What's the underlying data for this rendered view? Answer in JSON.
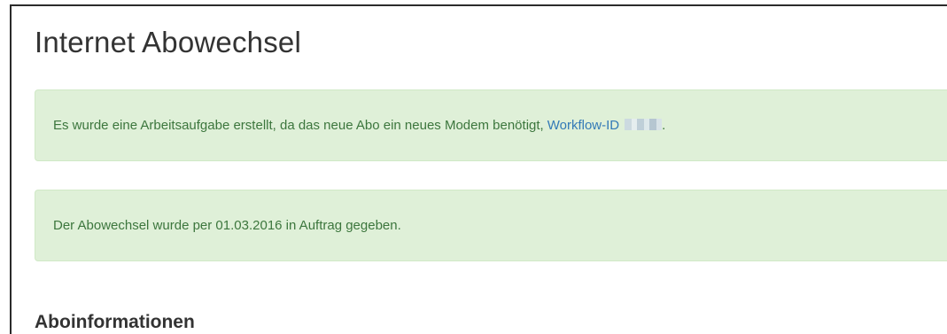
{
  "page": {
    "title": "Internet Abowechsel"
  },
  "alerts": [
    {
      "text": "Es wurde eine Arbeitsaufgabe erstellt, da das neue Abo ein neues Modem benötigt,",
      "link_label": "Workflow-ID",
      "link_suffix": "."
    },
    {
      "text": "Der Abowechsel wurde per 01.03.2016 in Auftrag gegeben."
    }
  ],
  "sections": {
    "aboinformationen": "Aboinformationen"
  },
  "colors": {
    "alert_background": "#dff0d8",
    "alert_text": "#3c763d",
    "link": "#337ab7"
  }
}
